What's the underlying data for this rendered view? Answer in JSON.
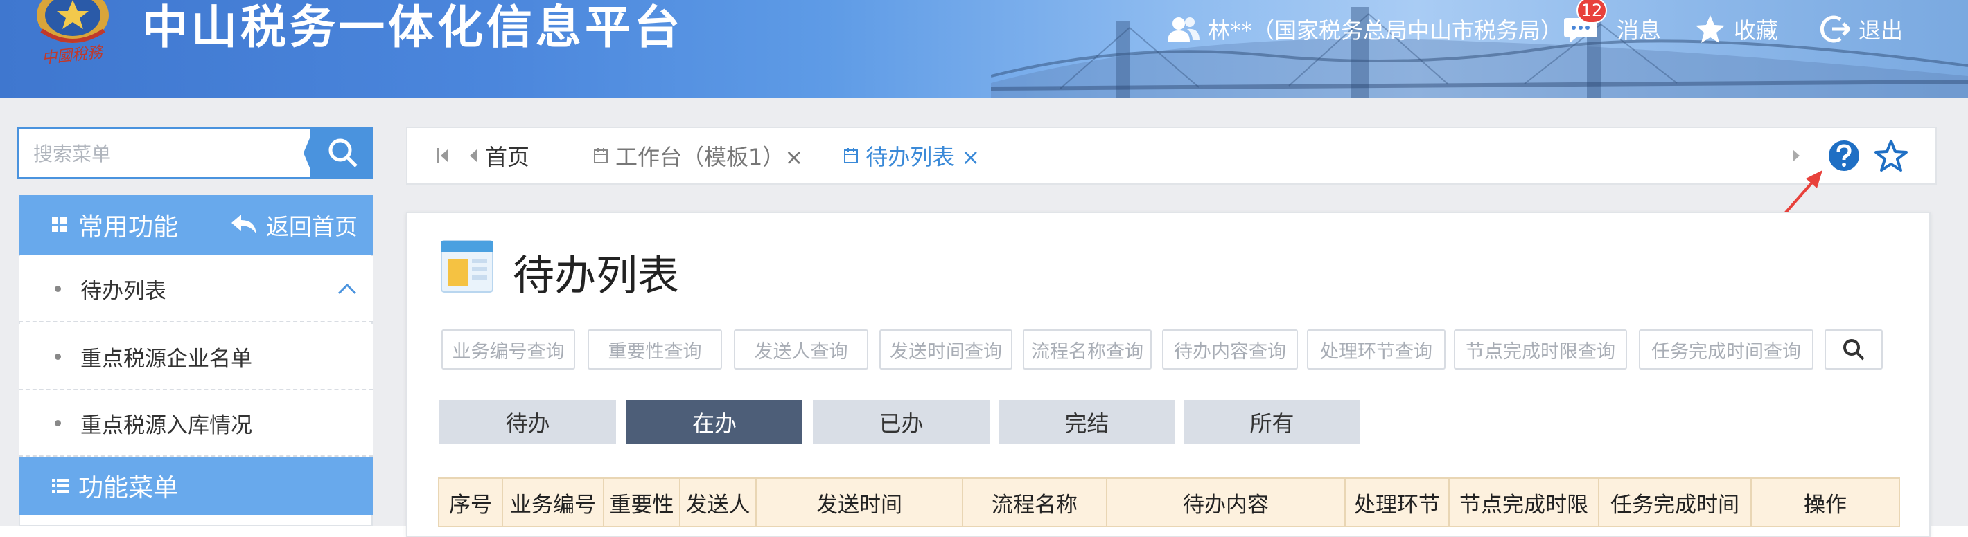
{
  "header": {
    "logo_text": "中國稅務",
    "title": "中山税务一体化信息平台",
    "user": "林**（国家税务总局中山市税务局）",
    "message_badge": "12",
    "message_label": "消息",
    "favorite_label": "收藏",
    "logout_label": "退出",
    "colors": {
      "primary": "#3f77cf",
      "badge": "#e8413b"
    }
  },
  "sidebar": {
    "search_placeholder": "搜索菜单",
    "common_title": "常用功能",
    "back_home_label": "返回首页",
    "items": [
      {
        "label": "待办列表"
      },
      {
        "label": "重点税源企业名单"
      },
      {
        "label": "重点税源入库情况"
      }
    ],
    "menu_title": "功能菜单"
  },
  "tabs": {
    "home_label": "首页",
    "items": [
      {
        "label": "工作台（模板1）×"
      },
      {
        "label": "待办列表 ×"
      }
    ]
  },
  "main": {
    "page_title": "待办列表",
    "filters": [
      "业务编号查询",
      "重要性查询",
      "发送人查询",
      "发送时间查询",
      "流程名称查询",
      "待办内容查询",
      "处理环节查询",
      "节点完成时限查询",
      "任务完成时间查询"
    ],
    "status_tabs": [
      {
        "label": "待办",
        "active": false
      },
      {
        "label": "在办",
        "active": true
      },
      {
        "label": "已办",
        "active": false
      },
      {
        "label": "完结",
        "active": false
      },
      {
        "label": "所有",
        "active": false
      }
    ],
    "columns": [
      "序号",
      "业务编号",
      "重要性",
      "发送人",
      "发送时间",
      "流程名称",
      "待办内容",
      "处理环节",
      "节点完成时限",
      "任务完成时间",
      "操作"
    ]
  },
  "annotation": {
    "arrow_color": "#e8413b"
  }
}
